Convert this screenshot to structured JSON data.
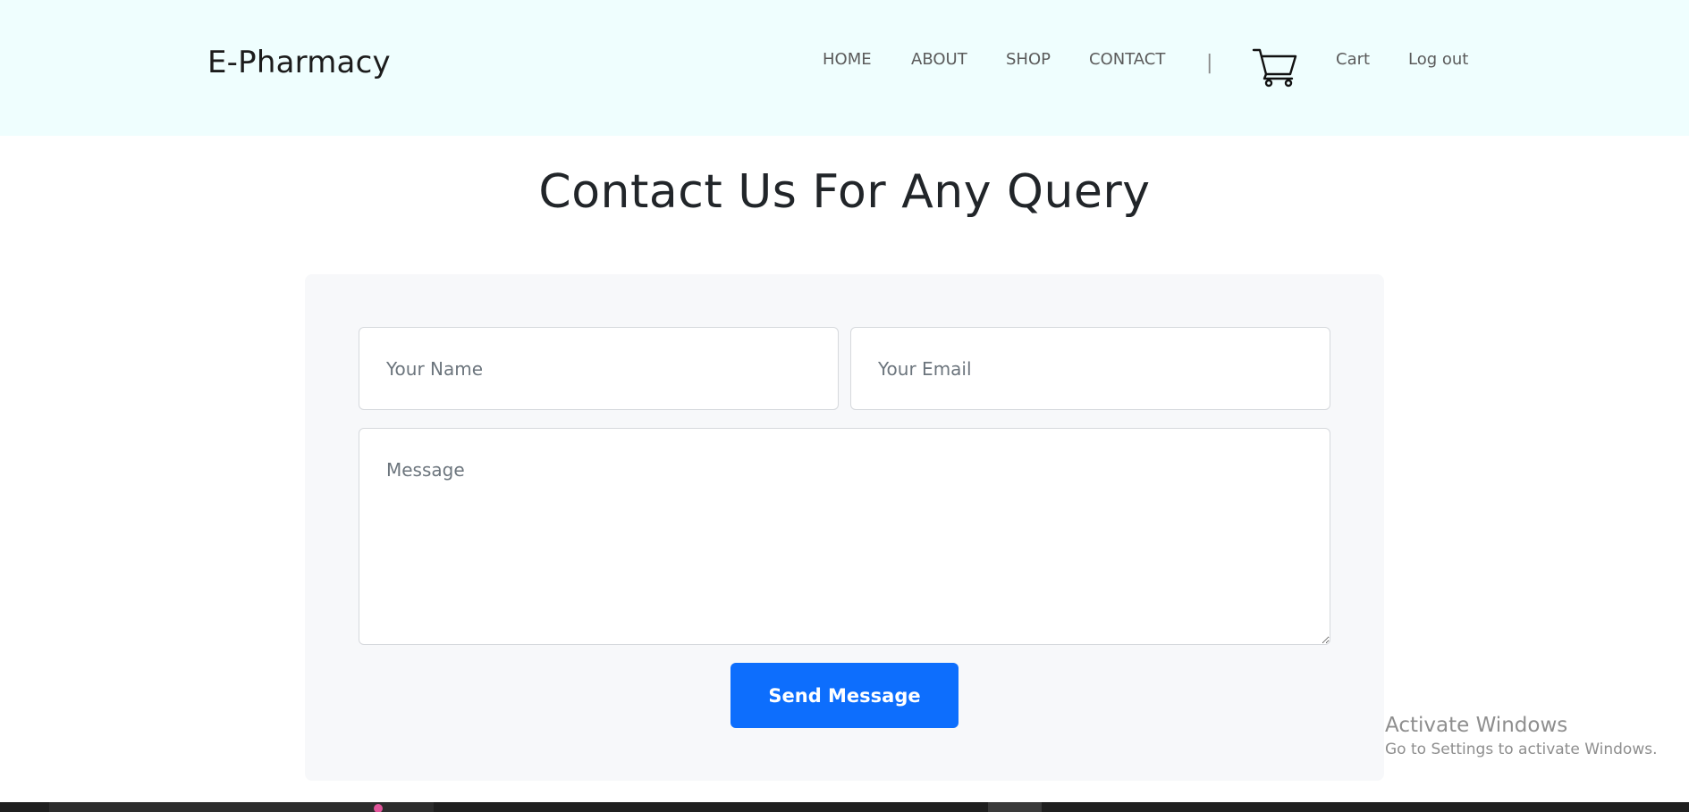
{
  "header": {
    "brand": "E-Pharmacy",
    "nav": [
      {
        "label": "HOME",
        "name": "nav-home"
      },
      {
        "label": "ABOUT",
        "name": "nav-about"
      },
      {
        "label": "SHOP",
        "name": "nav-shop"
      },
      {
        "label": "CONTACT",
        "name": "nav-contact"
      }
    ],
    "separator": "|",
    "cart_icon": "cart-icon",
    "cart_label": "Cart",
    "logout_label": "Log out"
  },
  "main": {
    "title": "Contact Us For Any Query",
    "form": {
      "name_placeholder": "Your Name",
      "name_value": "",
      "email_placeholder": "Your Email",
      "email_value": "",
      "message_placeholder": "Message",
      "message_value": "",
      "submit_label": "Send Message"
    }
  },
  "watermark": {
    "title": "Activate Windows",
    "subtitle": "Go to Settings to activate Windows."
  },
  "colors": {
    "header_bg": "#effefe",
    "card_bg": "#f7f8fa",
    "button_bg": "#0d6efd",
    "button_text": "#ffffff"
  }
}
